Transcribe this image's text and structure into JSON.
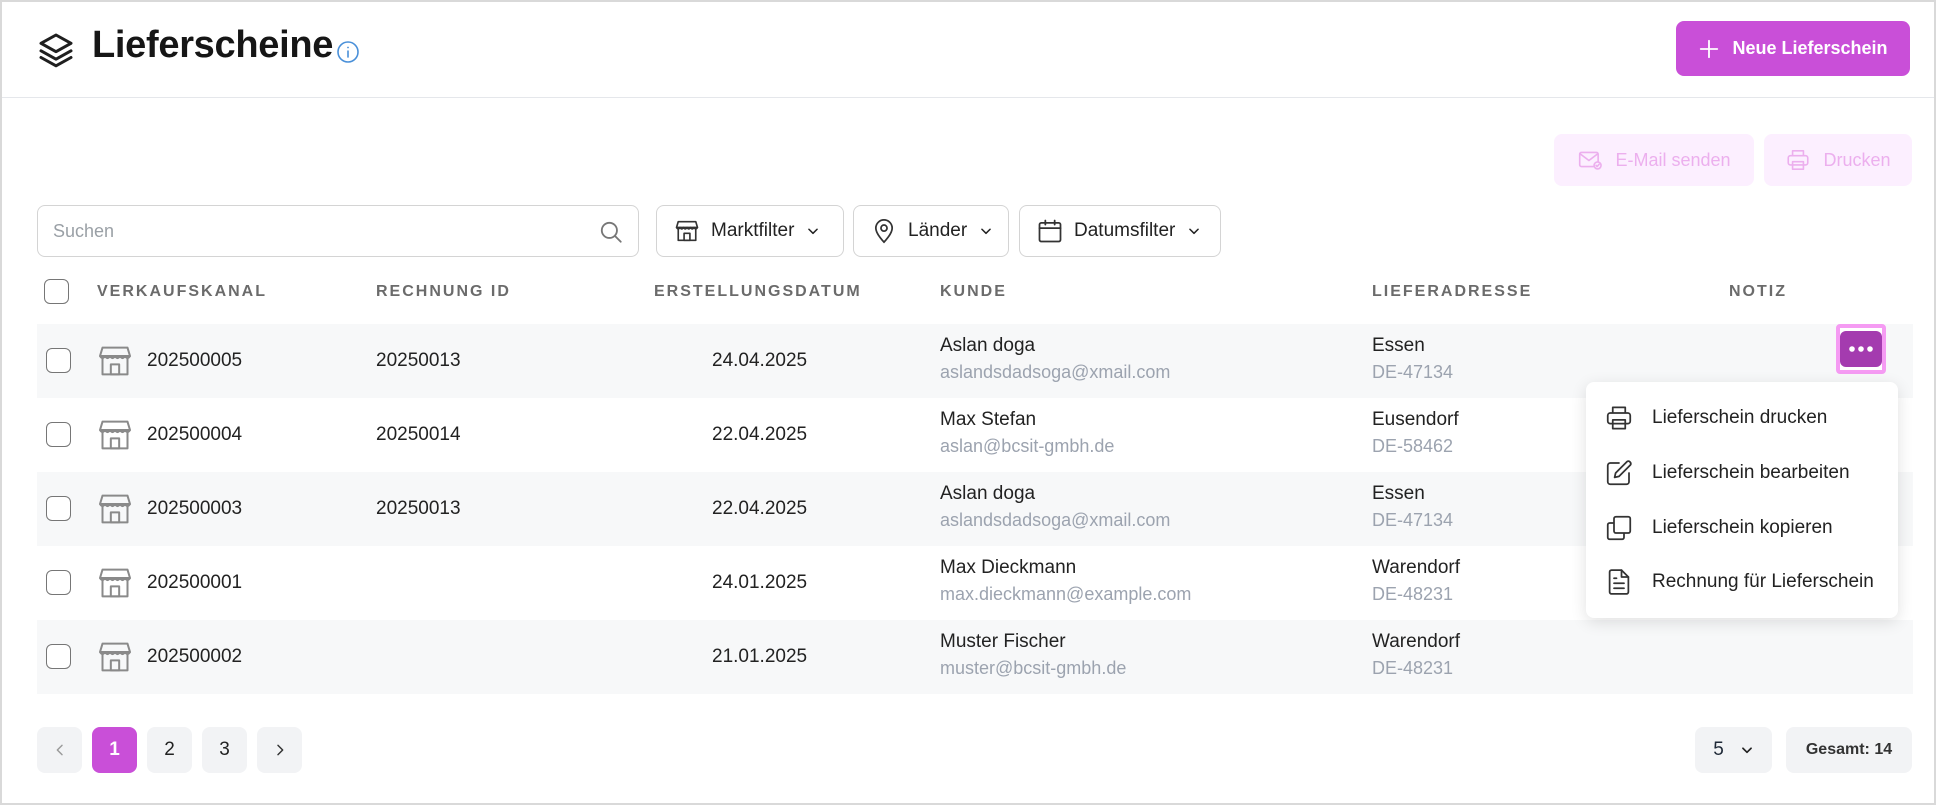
{
  "header": {
    "title": "Lieferscheine",
    "new_button_label": "Neue Lieferschein",
    "icon": "layers-icon",
    "info_icon": "info-icon"
  },
  "actions": {
    "email_label": "E-Mail senden",
    "print_label": "Drucken"
  },
  "search": {
    "placeholder": "Suchen",
    "value": ""
  },
  "filters": {
    "market": "Marktfilter",
    "countries": "Länder",
    "date": "Datumsfilter"
  },
  "table": {
    "columns": [
      "VERKAUFSKANAL",
      "RECHNUNG ID",
      "ERSTELLUNGSDATUM",
      "KUNDE",
      "LIEFERADRESSE",
      "NOTIZ"
    ],
    "rows": [
      {
        "channel": "202500005",
        "invoice_id": "20250013",
        "date": "24.04.2025",
        "customer_name": "Aslan doga",
        "customer_email": "aslandsdadsoga@xmail.com",
        "city": "Essen",
        "zip": "DE-47134"
      },
      {
        "channel": "202500004",
        "invoice_id": "20250014",
        "date": "22.04.2025",
        "customer_name": "Max Stefan",
        "customer_email": "aslan@bcsit-gmbh.de",
        "city": "Eusendorf",
        "zip": "DE-58462"
      },
      {
        "channel": "202500003",
        "invoice_id": "20250013",
        "date": "22.04.2025",
        "customer_name": "Aslan doga",
        "customer_email": "aslandsdadsoga@xmail.com",
        "city": "Essen",
        "zip": "DE-47134"
      },
      {
        "channel": "202500001",
        "invoice_id": "",
        "date": "24.01.2025",
        "customer_name": "Max Dieckmann",
        "customer_email": "max.dieckmann@example.com",
        "city": "Warendorf",
        "zip": "DE-48231"
      },
      {
        "channel": "202500002",
        "invoice_id": "",
        "date": "21.01.2025",
        "customer_name": "Muster Fischer",
        "customer_email": "muster@bcsit-gmbh.de",
        "city": "Warendorf",
        "zip": "DE-48231"
      }
    ]
  },
  "context_menu": {
    "items": [
      {
        "label": "Lieferschein drucken",
        "icon": "printer-icon"
      },
      {
        "label": "Lieferschein bearbeiten",
        "icon": "edit-icon"
      },
      {
        "label": "Lieferschein kopieren",
        "icon": "copy-icon"
      },
      {
        "label": "Rechnung für Lieferschein",
        "icon": "document-icon"
      }
    ]
  },
  "pagination": {
    "pages": [
      "1",
      "2",
      "3"
    ],
    "current_page": "1",
    "per_page": "5",
    "total_label": "Gesamt: 14"
  },
  "colors": {
    "accent": "#c94fd8",
    "accent_dark": "#a43baf",
    "highlight": "#f59bf3",
    "disabled_bg": "#fcefff",
    "disabled_text": "#ecafee"
  }
}
